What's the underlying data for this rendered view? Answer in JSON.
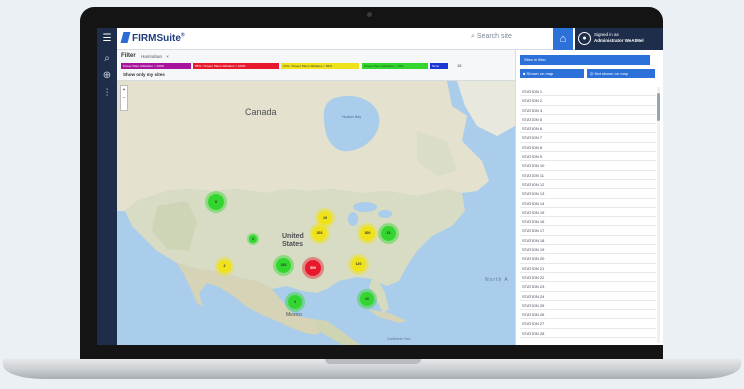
{
  "header": {
    "brand": "FIRMSuite",
    "brand_mark": "®",
    "search_placeholder": "Search site",
    "signed_in_line1": "Signed in as",
    "signed_in_line2": "Administrator WeAtMel"
  },
  "icons": {
    "menu": "hamburger-icon",
    "search": "search-icon",
    "home": "home-icon",
    "user": "user-icon",
    "sidebar": [
      "search-icon",
      "add-circle-icon",
      "sliders-icon"
    ]
  },
  "filter": {
    "title": "Filter",
    "subtitle": "Hamrahan",
    "subtitle_close": "×",
    "chips": [
      {
        "label": "Power Plant Utilization > 100%",
        "color": "#a7139a"
      },
      {
        "label": "85% < Power Plant Utilization < 100%",
        "color": "#e8192c"
      },
      {
        "label": "70% < Power Plant Utilization < 84%",
        "color": "#f0e21a"
      },
      {
        "label": "Power Plant Utilization < 70%",
        "color": "#32d62e"
      },
      {
        "label": "None",
        "color": "#1b38d6"
      }
    ],
    "value": "15",
    "show_only": "Show only my sites"
  },
  "map": {
    "zoom_in": "+",
    "zoom_out": "−",
    "labels": {
      "canada": "Canada",
      "us_line1": "United",
      "us_line2": "States",
      "mexico": "Mexico",
      "hudson": "Hudson Bay",
      "north_atlantic": "North A",
      "caribbean": "Caribbean Sea"
    },
    "clusters": [
      {
        "label": "8",
        "color": "#32d62e"
      },
      {
        "label": "19",
        "color": "#f0e21a"
      },
      {
        "label": "4",
        "color": "#32d62e"
      },
      {
        "label": "203",
        "color": "#f0e21a"
      },
      {
        "label": "300",
        "color": "#f0e21a"
      },
      {
        "label": "15",
        "color": "#32d62e"
      },
      {
        "label": "2",
        "color": "#f0e21a"
      },
      {
        "label": "180",
        "color": "#32d62e"
      },
      {
        "label": "500",
        "color": "#e8192c"
      },
      {
        "label": "120",
        "color": "#f0e21a"
      },
      {
        "label": "3",
        "color": "#32d62e"
      },
      {
        "label": "20",
        "color": "#32d62e"
      }
    ]
  },
  "panel": {
    "header": "Sites in filter",
    "shown_on_map": "Shown on map",
    "not_shown_on_map": "Not shown on map",
    "stations": [
      "STATION 1",
      "STATION 2",
      "STATION 3",
      "STATION 5",
      "STATION 6",
      "STATION 7",
      "STATION 8",
      "STATION 9",
      "STATION 10",
      "STATION 11",
      "STATION 12",
      "STATION 13",
      "STATION 14",
      "STATION 15",
      "STATION 16",
      "STATION 17",
      "STATION 18",
      "STATION 19",
      "STATION 20",
      "STATION 21",
      "STATION 22",
      "STATION 23",
      "STATION 24",
      "STATION 25",
      "STATION 26",
      "STATION 27",
      "STATION 28"
    ]
  }
}
